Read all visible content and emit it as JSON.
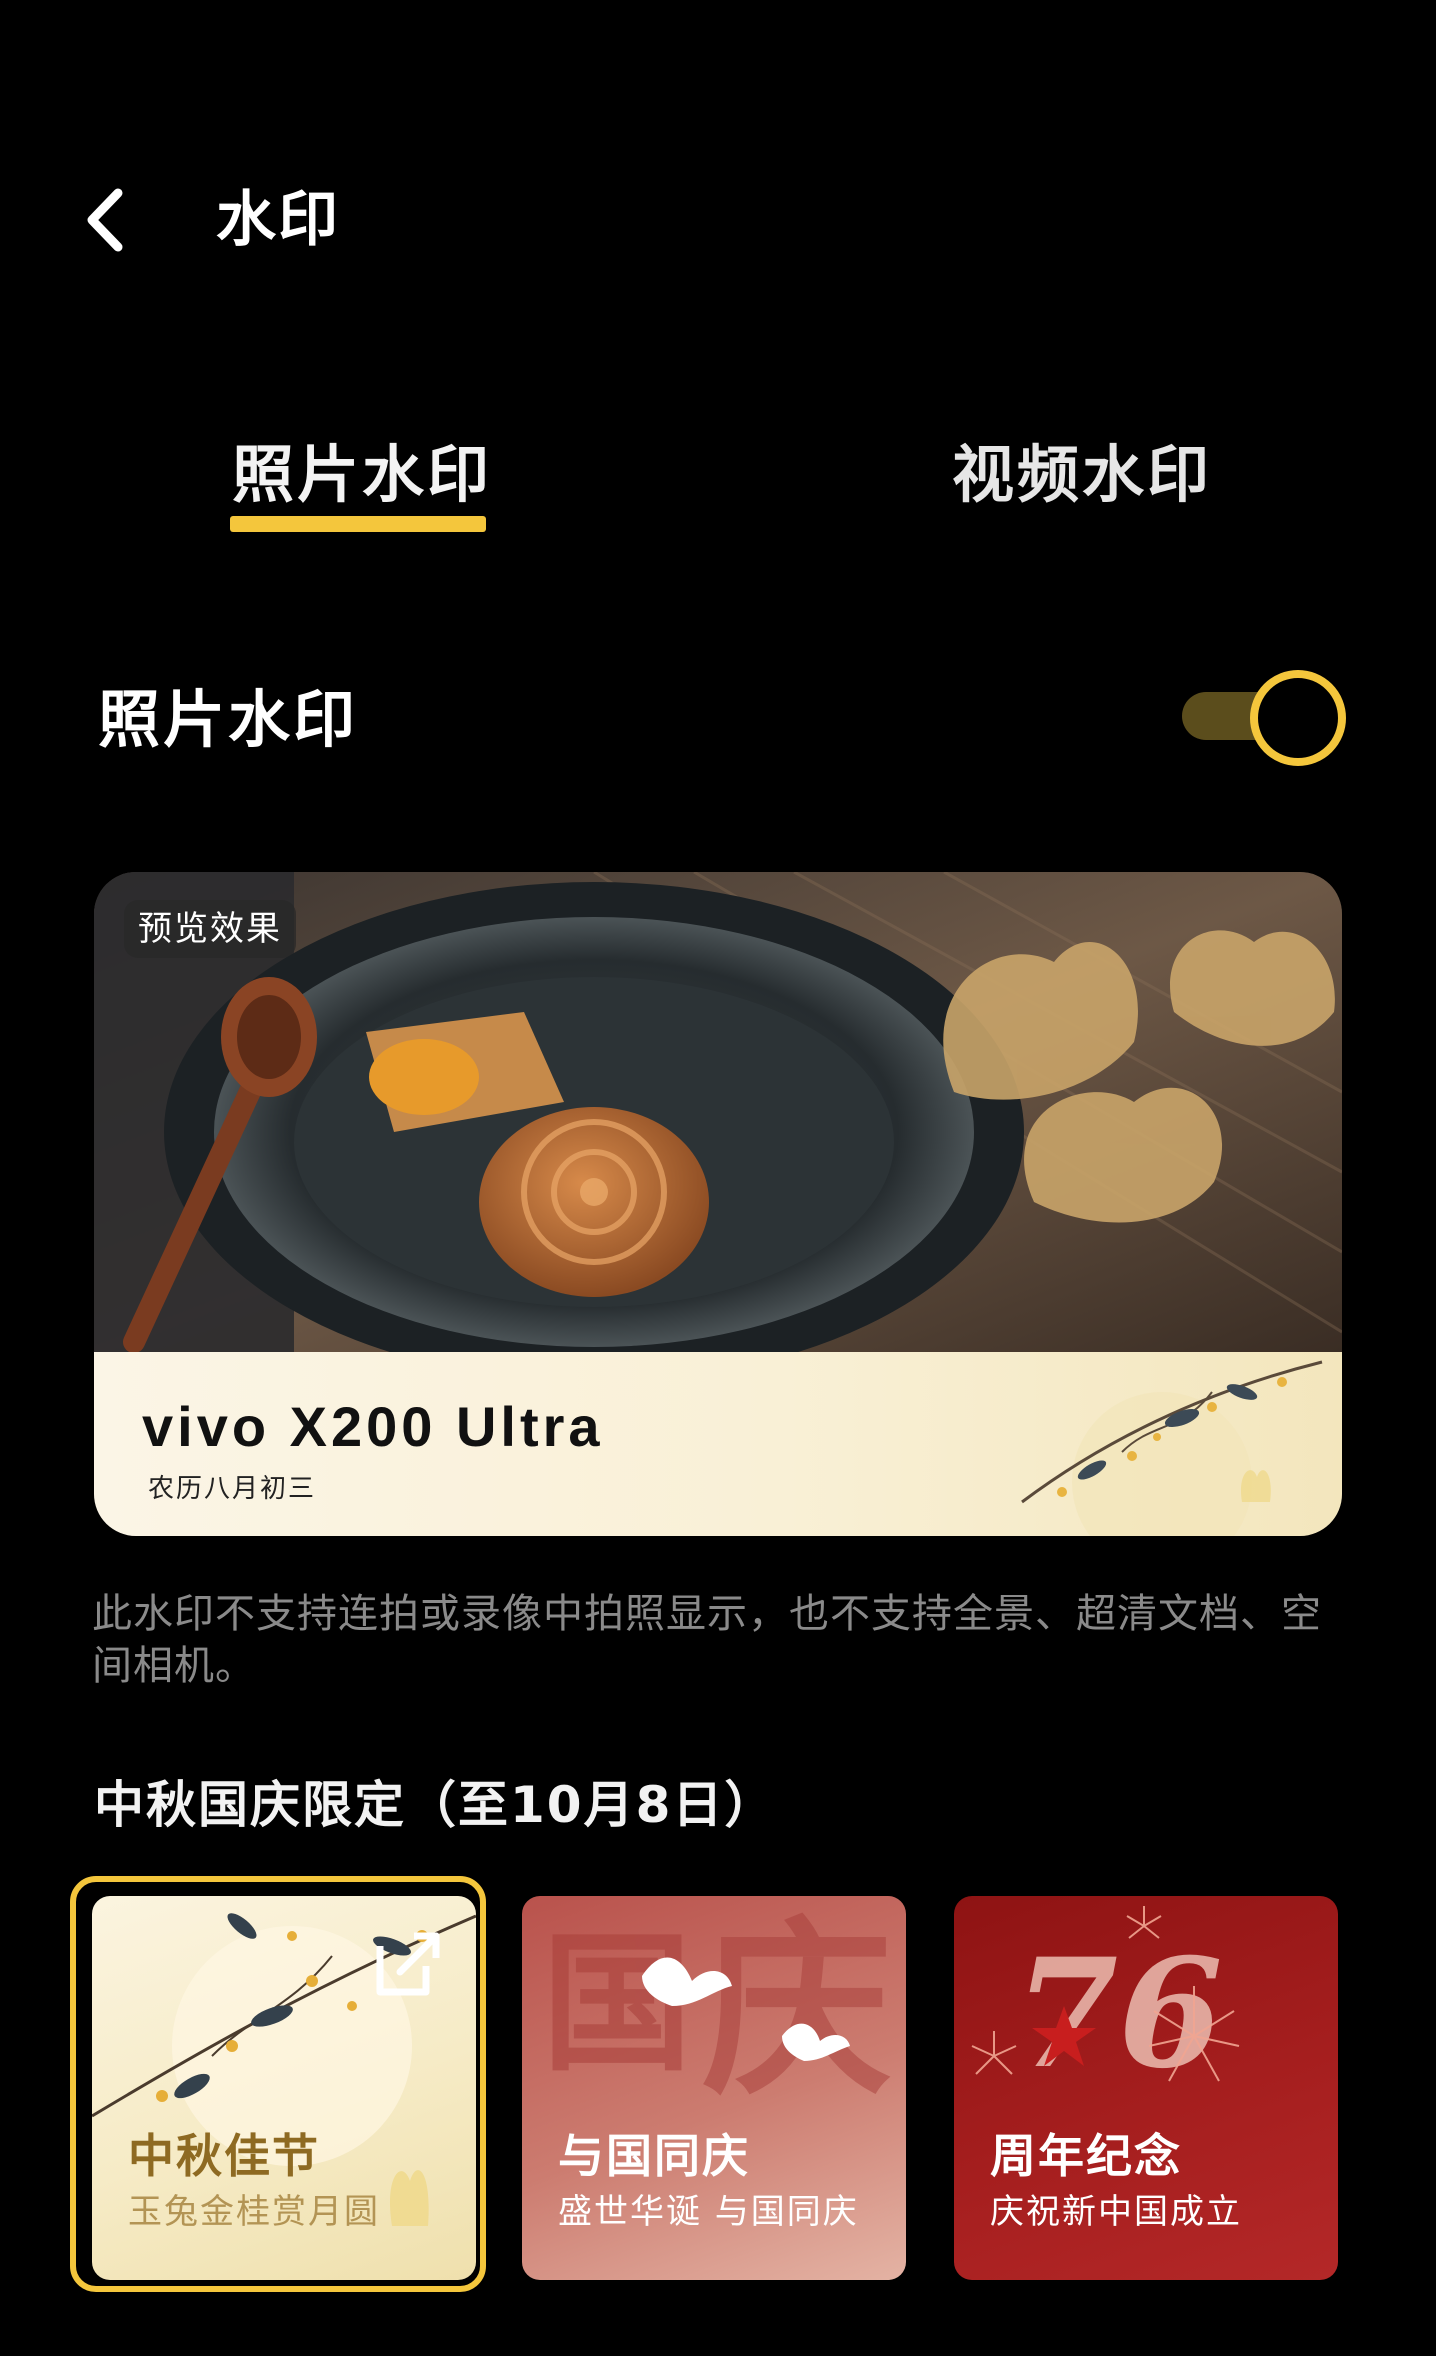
{
  "header": {
    "title": "水印",
    "back_icon": "chevron-left-icon"
  },
  "tabs": [
    {
      "label": "照片水印",
      "active": true
    },
    {
      "label": "视频水印",
      "active": false
    }
  ],
  "accent_color": "#f4c63c",
  "photo_watermark_toggle": {
    "label": "照片水印",
    "enabled": true
  },
  "preview": {
    "badge": "预览效果",
    "brand_text": "vivo  X200 Ultra",
    "date_text": "农历八月初三"
  },
  "notice": "此水印不支持连拍或录像中拍照显示，也不支持全景、超清文档、空间相机。",
  "limited_section": {
    "title": "中秋国庆限定（至10月8日）",
    "themes": [
      {
        "name": "中秋佳节",
        "subtitle": "玉兔金桂赏月圆",
        "selected": true,
        "icon": "edit-icon"
      },
      {
        "name": "与国同庆",
        "subtitle": "盛世华诞 与国同庆",
        "selected": false
      },
      {
        "name": "周年纪念",
        "subtitle": "庆祝新中国成立",
        "selected": false
      }
    ]
  }
}
